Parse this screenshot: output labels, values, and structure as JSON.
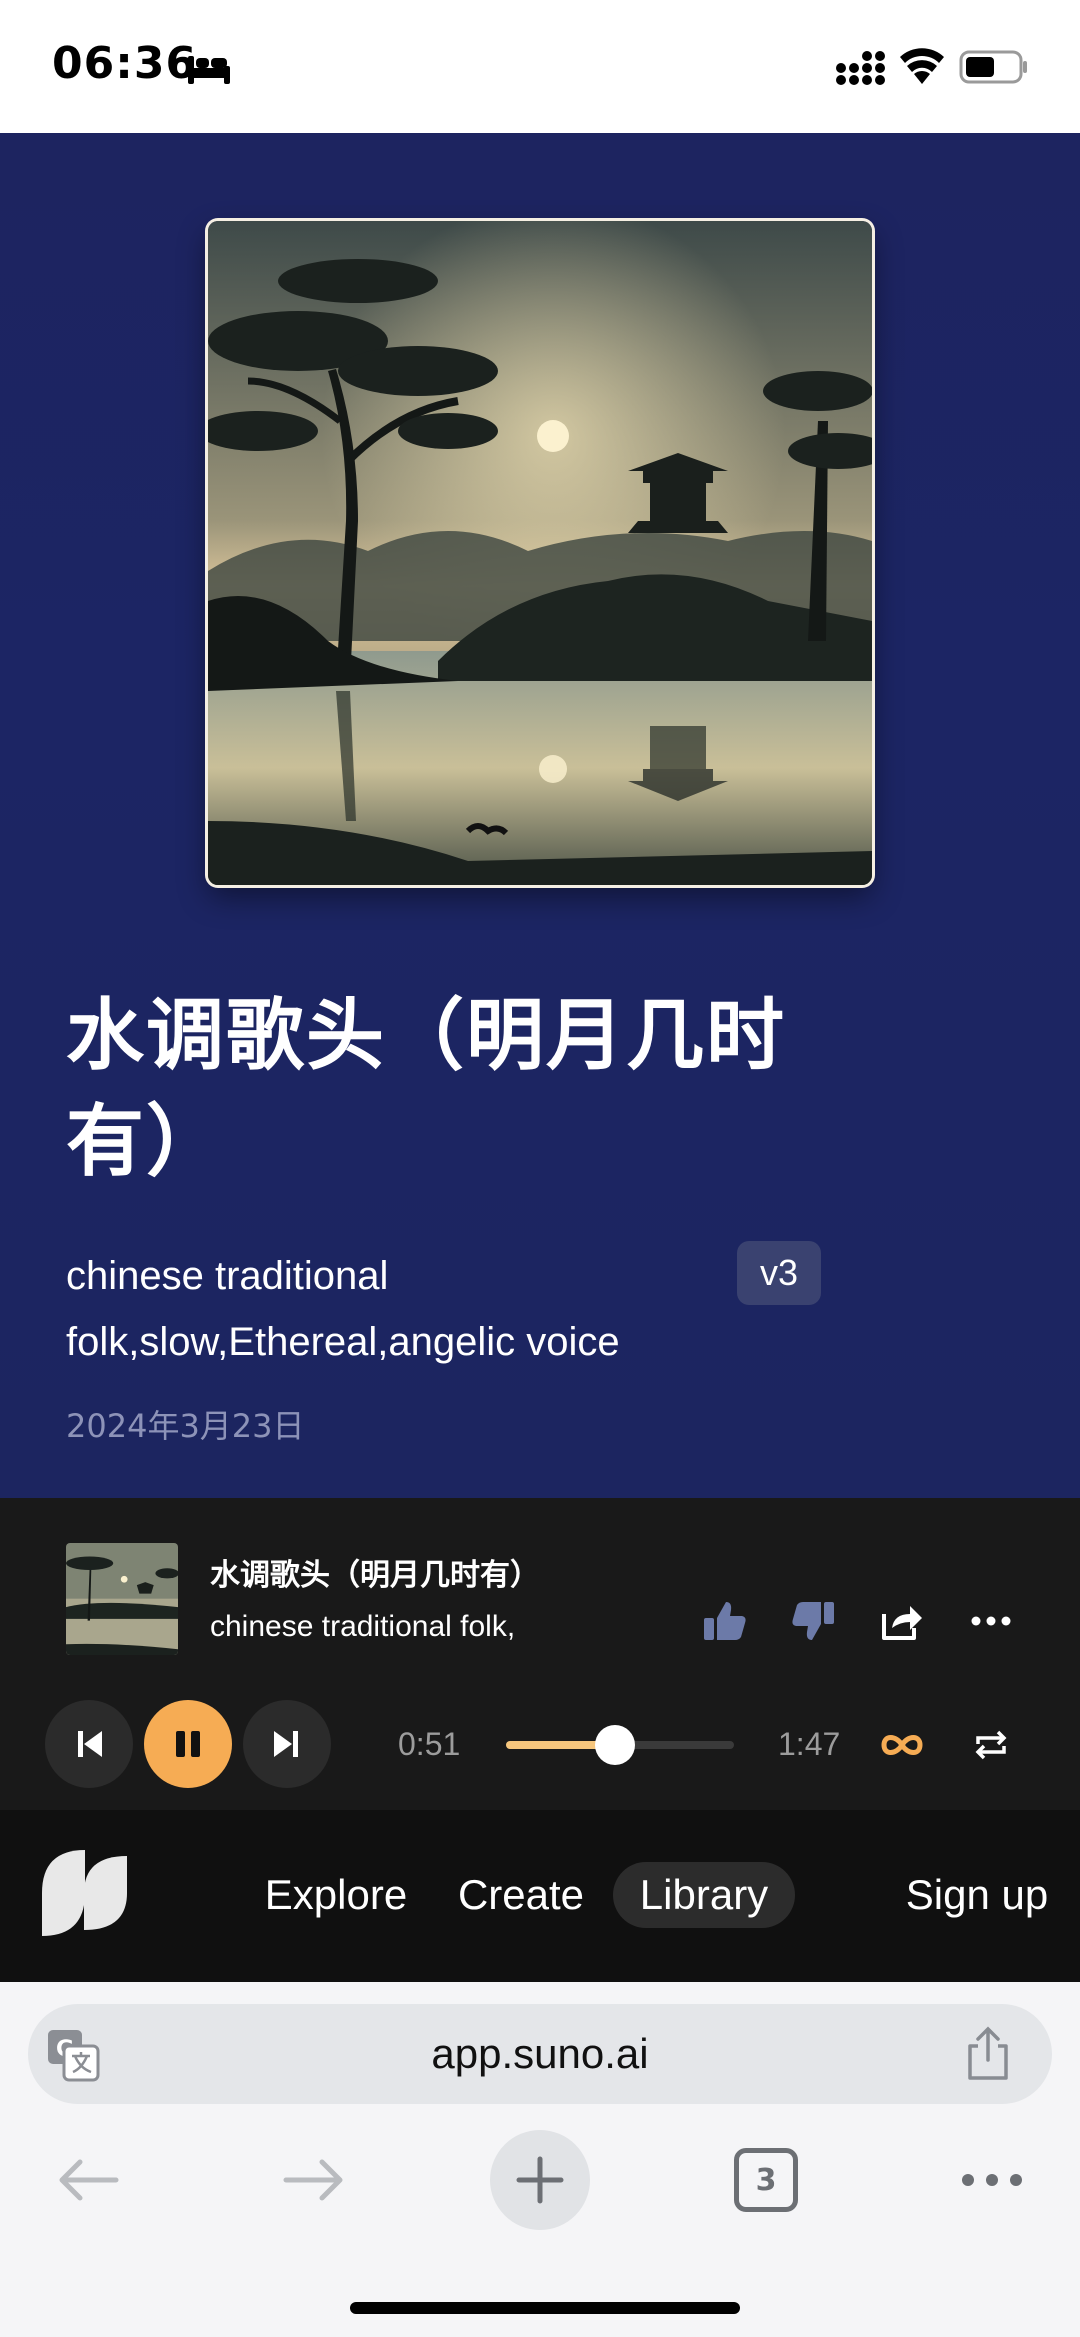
{
  "status_bar": {
    "time": "06:36",
    "icons": [
      "bed-icon",
      "signal-icon",
      "wifi-icon",
      "battery-icon"
    ]
  },
  "song": {
    "title": "水调歌头（明月几时有）",
    "tags": "chinese traditional folk,slow,Ethereal,angelic voice",
    "version": "v3",
    "date": "2024年3月23日"
  },
  "player": {
    "title": "水调歌头（明月几时有）",
    "tags_preview": "chinese traditional folk,",
    "current_time": "0:51",
    "duration": "1:47",
    "progress_fraction": 0.477,
    "state": "playing",
    "accent_color": "#f6ac54",
    "actions": [
      "thumbs-up-icon",
      "thumbs-down-icon",
      "share-icon",
      "more-icon"
    ]
  },
  "nav": {
    "items": [
      {
        "label": "Explore",
        "active": false
      },
      {
        "label": "Create",
        "active": false
      },
      {
        "label": "Library",
        "active": true
      }
    ],
    "signup_label": "Sign up"
  },
  "browser": {
    "url": "app.suno.ai",
    "tab_count": "3"
  }
}
